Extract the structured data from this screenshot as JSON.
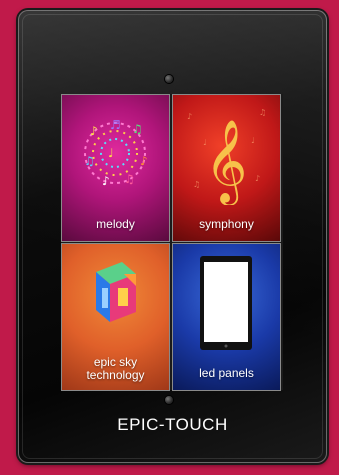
{
  "tiles": [
    {
      "label": "melody",
      "icon": "music-notes-swirl-icon"
    },
    {
      "label": "symphony",
      "icon": "treble-clef-icon"
    },
    {
      "label_line1": "epic sky",
      "label_line2": "technology",
      "icon": "epic-sky-cube-logo-icon"
    },
    {
      "label": "led panels",
      "icon": "tablet-screen-icon"
    }
  ],
  "brand": "EPIC-TOUCH",
  "colors": {
    "frame_background": "#c01a4a",
    "melody_tile": "#b0157a",
    "symphony_tile": "#c01818",
    "epic_tile": "#e0602a",
    "led_tile": "#1a3aa8"
  }
}
